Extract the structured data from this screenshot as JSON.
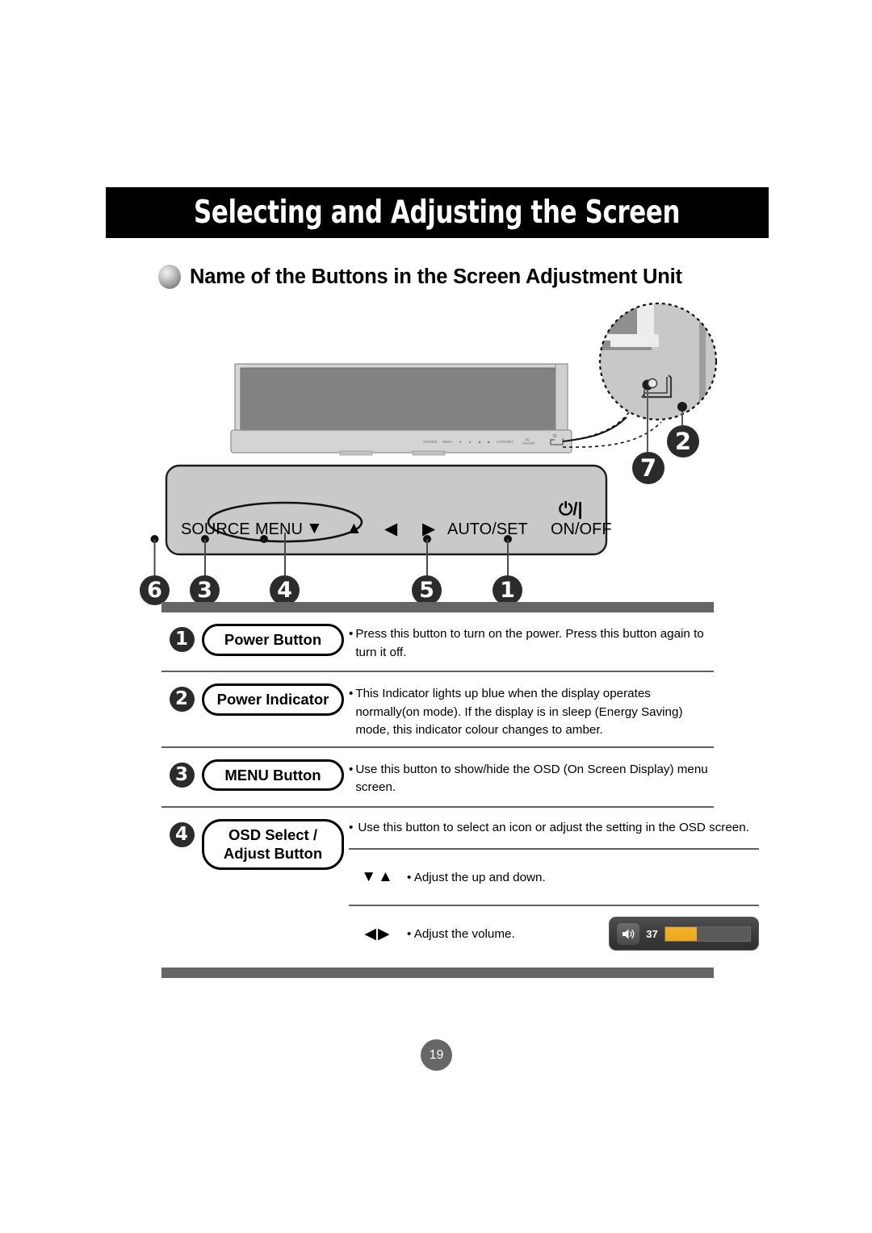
{
  "page": {
    "banner_title": "Selecting and Adjusting the Screen",
    "section_heading": "Name of the Buttons in the Screen Adjustment Unit",
    "page_number": "19"
  },
  "control_panel": {
    "source_label": "SOURCE",
    "menu_label": "MENU",
    "arrow_down": "▼",
    "arrow_up": "▲",
    "arrow_left": "◀",
    "arrow_right": "▶",
    "auto_set_label": "AUTO/SET",
    "power_symbol": "⏻/|",
    "on_off_label": "ON/OFF",
    "callouts": [
      "6",
      "3",
      "4",
      "5",
      "1"
    ]
  },
  "monitor_illustration": {
    "magnifier_callouts": [
      "2",
      "7"
    ]
  },
  "table": {
    "rows": [
      {
        "badge": "1",
        "label": "Power Button",
        "description": "Press this button to turn on the power. Press this button again to turn it off."
      },
      {
        "badge": "2",
        "label": "Power Indicator",
        "description": "This Indicator lights up blue when the display operates normally(on mode). If the display is in sleep (Energy Saving) mode, this indicator colour changes to amber."
      },
      {
        "badge": "3",
        "label": "MENU Button",
        "description": "Use this button to show/hide the OSD (On Screen Display) menu screen."
      },
      {
        "badge": "4",
        "label_line1": "OSD Select /",
        "label_line2": "Adjust Button",
        "description": "Use this button to select an icon or adjust the setting in the OSD screen.",
        "sub_rows": [
          {
            "arrows": "▼▲",
            "text": "Adjust the up and down."
          },
          {
            "arrows": "◀▶",
            "text": "Adjust the volume.",
            "volume_osd": {
              "value": "37",
              "fill_percent": 37,
              "fill_color": "#f5b12b",
              "icon": "speaker-icon"
            }
          }
        ]
      }
    ],
    "bullet_char": "•"
  }
}
